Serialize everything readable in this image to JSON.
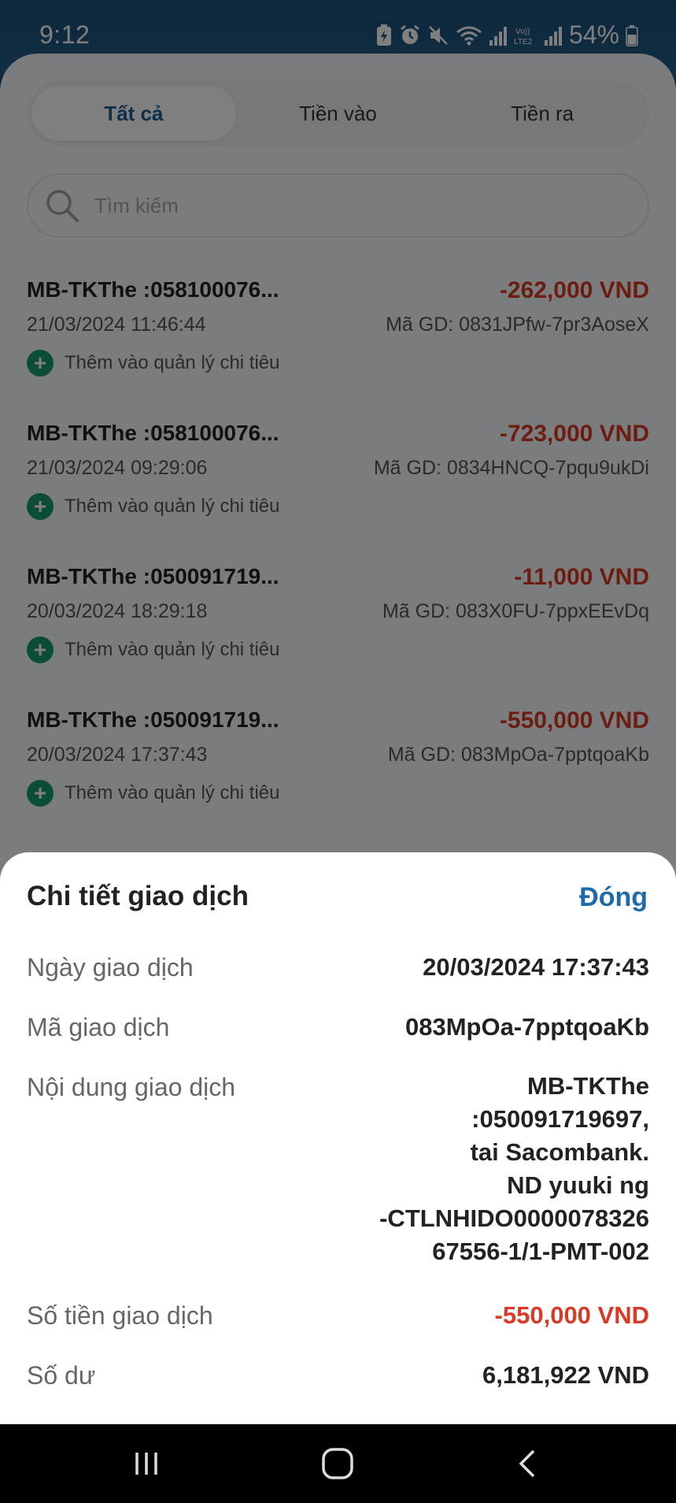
{
  "status_bar": {
    "time": "9:12",
    "battery": "54%",
    "icons": [
      "battery-saver-icon",
      "alarm-icon",
      "mute-icon",
      "wifi-icon",
      "signal-icon",
      "volte-icon",
      "signal-icon",
      "battery-icon"
    ]
  },
  "tabs": {
    "all": "Tất cả",
    "incoming": "Tiền vào",
    "outgoing": "Tiền ra",
    "active": "all"
  },
  "search": {
    "placeholder": "Tìm kiếm"
  },
  "transactions": [
    {
      "title": "MB-TKThe :058100076...",
      "amount": "-262,000 VND",
      "date": "21/03/2024 11:46:44",
      "code": "Mã GD: 0831JPfw-7pr3AoseX",
      "add_label": "Thêm vào quản lý chi tiêu"
    },
    {
      "title": "MB-TKThe :058100076...",
      "amount": "-723,000 VND",
      "date": "21/03/2024 09:29:06",
      "code": "Mã GD: 0834HNCQ-7pqu9ukDi",
      "add_label": "Thêm vào quản lý chi tiêu"
    },
    {
      "title": "MB-TKThe :050091719...",
      "amount": "-11,000 VND",
      "date": "20/03/2024 18:29:18",
      "code": "Mã GD: 083X0FU-7ppxEEvDq",
      "add_label": "Thêm vào quản lý chi tiêu"
    },
    {
      "title": "MB-TKThe :050091719...",
      "amount": "-550,000 VND",
      "date": "20/03/2024 17:37:43",
      "code": "Mã GD: 083MpOa-7pptqoaKb",
      "add_label": "Thêm vào quản lý chi tiêu"
    }
  ],
  "detail": {
    "title": "Chi tiết giao dịch",
    "close": "Đóng",
    "date_label": "Ngày giao dịch",
    "date_value": "20/03/2024 17:37:43",
    "code_label": "Mã giao dịch",
    "code_value": "083MpOa-7pptqoaKb",
    "content_label": "Nội dung giao dịch",
    "content_lines": [
      "MB-TKThe",
      ":050091719697,",
      "tai Sacombank.",
      "ND  yuuki ng",
      "-CTLNHIDO0000078326",
      "67556-1/1-PMT-002"
    ],
    "amount_label": "Số tiền giao dịch",
    "amount_value": "-550,000 VND",
    "balance_label": "Số dư",
    "balance_value": "6,181,922 VND"
  },
  "colors": {
    "accent": "#1c5e95",
    "negative": "#d93a25",
    "add_icon": "#169b6f"
  }
}
